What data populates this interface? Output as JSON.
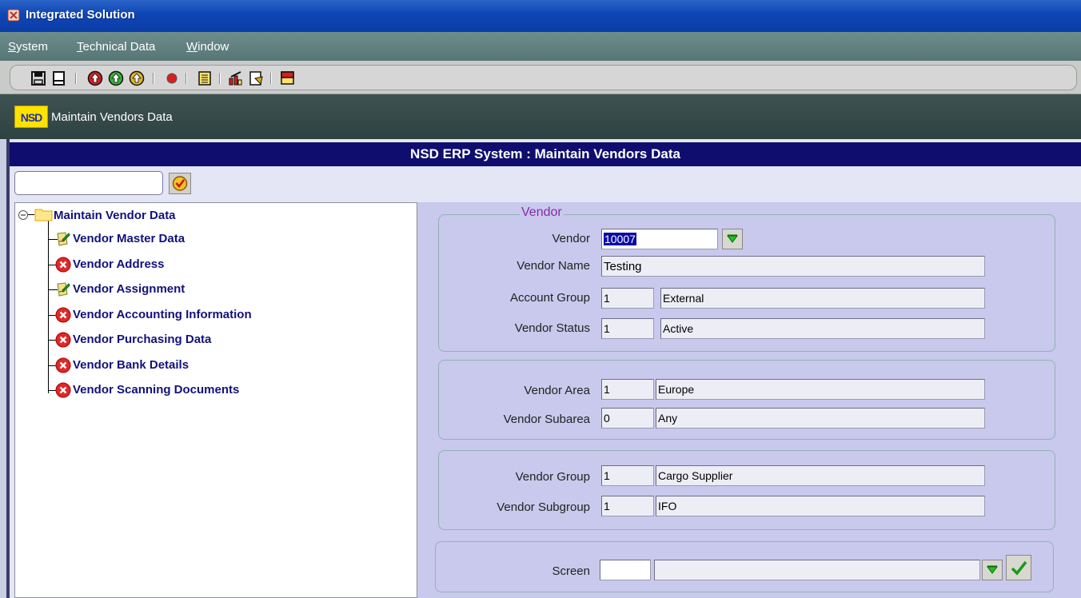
{
  "window": {
    "title": "Integrated Solution"
  },
  "menu": [
    {
      "label": "System",
      "mnemonic": "S"
    },
    {
      "label": "Technical Data",
      "mnemonic": "T"
    },
    {
      "label": "Window",
      "mnemonic": "W"
    }
  ],
  "toolbar_icons": [
    "save-icon",
    "print-icon",
    "first-record-icon",
    "next-record-icon",
    "previous-record-icon",
    "record-icon",
    "list-icon",
    "chart-icon",
    "query-icon",
    "exit-icon"
  ],
  "screen": {
    "logo": "NSD",
    "title": "Maintain Vendors Data"
  },
  "header": {
    "title": "NSD ERP System : Maintain Vendors Data"
  },
  "tree": {
    "root": "Maintain Vendor Data",
    "items": [
      {
        "label": "Vendor Master Data",
        "status": "done"
      },
      {
        "label": "Vendor Address",
        "status": "error"
      },
      {
        "label": "Vendor Assignment",
        "status": "done"
      },
      {
        "label": "Vendor Accounting Information",
        "status": "error"
      },
      {
        "label": "Vendor Purchasing Data",
        "status": "error"
      },
      {
        "label": "Vendor Bank Details",
        "status": "error"
      },
      {
        "label": "Vendor Scanning Documents",
        "status": "error"
      }
    ]
  },
  "form": {
    "legend": "Vendor",
    "vendor_label": "Vendor",
    "vendor_value": "10007",
    "vendor_name_label": "Vendor Name",
    "vendor_name_value": "Testing",
    "account_group_label": "Account Group",
    "account_group_code": "1",
    "account_group_desc": "External",
    "vendor_status_label": "Vendor Status",
    "vendor_status_code": "1",
    "vendor_status_desc": "Active",
    "vendor_area_label": "Vendor Area",
    "vendor_area_code": "1",
    "vendor_area_desc": "Europe",
    "vendor_subarea_label": "Vendor Subarea",
    "vendor_subarea_code": "0",
    "vendor_subarea_desc": "Any",
    "vendor_group_label": "Vendor Group",
    "vendor_group_code": "1",
    "vendor_group_desc": "Cargo Supplier",
    "vendor_subgroup_label": "Vendor Subgroup",
    "vendor_subgroup_code": "1",
    "vendor_subgroup_desc": "IFO",
    "screen_label": "Screen",
    "screen_code": "",
    "screen_desc": ""
  }
}
